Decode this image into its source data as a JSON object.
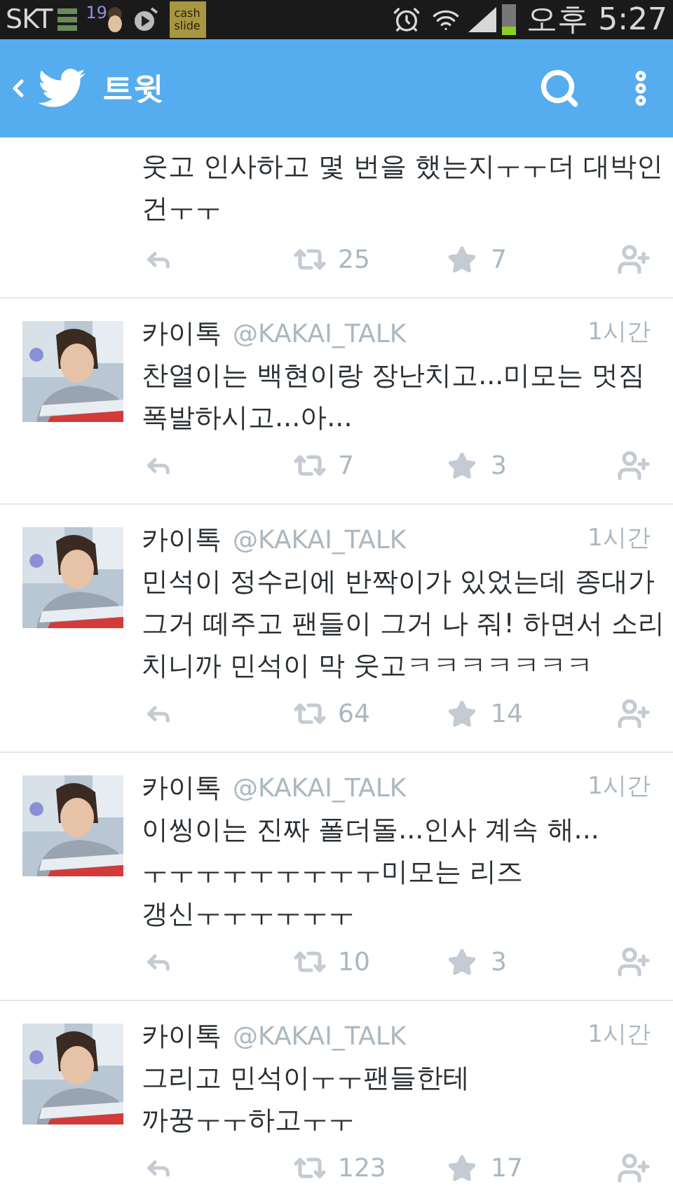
{
  "status_bar": {
    "carrier": "SKT",
    "badge": "19",
    "app_label": [
      "cash",
      "slide"
    ],
    "time": "오후 5:27"
  },
  "app_bar": {
    "title": "트윗"
  },
  "tweets": [
    {
      "kind": "partial",
      "lines": [
        "웃고 인사하고 몇 번을 했는지ㅜㅜ더 대박인",
        "건ㅜㅜ"
      ],
      "retweets": "25",
      "favorites": "7"
    },
    {
      "kind": "full",
      "name": "카이톡",
      "handle": "@KAKAI_TALK",
      "time": "1시간",
      "lines": [
        "찬열이는 백현이랑 장난치고...미모는 멋짐",
        "폭발하시고...아..."
      ],
      "retweets": "7",
      "favorites": "3"
    },
    {
      "kind": "full",
      "name": "카이톡",
      "handle": "@KAKAI_TALK",
      "time": "1시간",
      "lines": [
        "민석이 정수리에 반짝이가 있었는데 종대가",
        "그거 떼주고 팬들이 그거 나 줘! 하면서 소리",
        "치니까 민석이 막 웃고ㅋㅋㅋㅋㅋㅋㅋ"
      ],
      "retweets": "64",
      "favorites": "14"
    },
    {
      "kind": "full",
      "name": "카이톡",
      "handle": "@KAKAI_TALK",
      "time": "1시간",
      "lines": [
        "이씽이는 진짜 폴더돌...인사 계속 해...",
        "ㅜㅜㅜㅜㅜㅜㅜㅜㅜ미모는 리즈",
        "갱신ㅜㅜㅜㅜㅜㅜ"
      ],
      "retweets": "10",
      "favorites": "3"
    },
    {
      "kind": "full",
      "name": "카이톡",
      "handle": "@KAKAI_TALK",
      "time": "1시간",
      "lines": [
        "그리고 민석이ㅜㅜ팬들한테",
        "까꿍ㅜㅜ하고ㅜㅜ"
      ],
      "retweets": "123",
      "favorites": "17"
    }
  ]
}
